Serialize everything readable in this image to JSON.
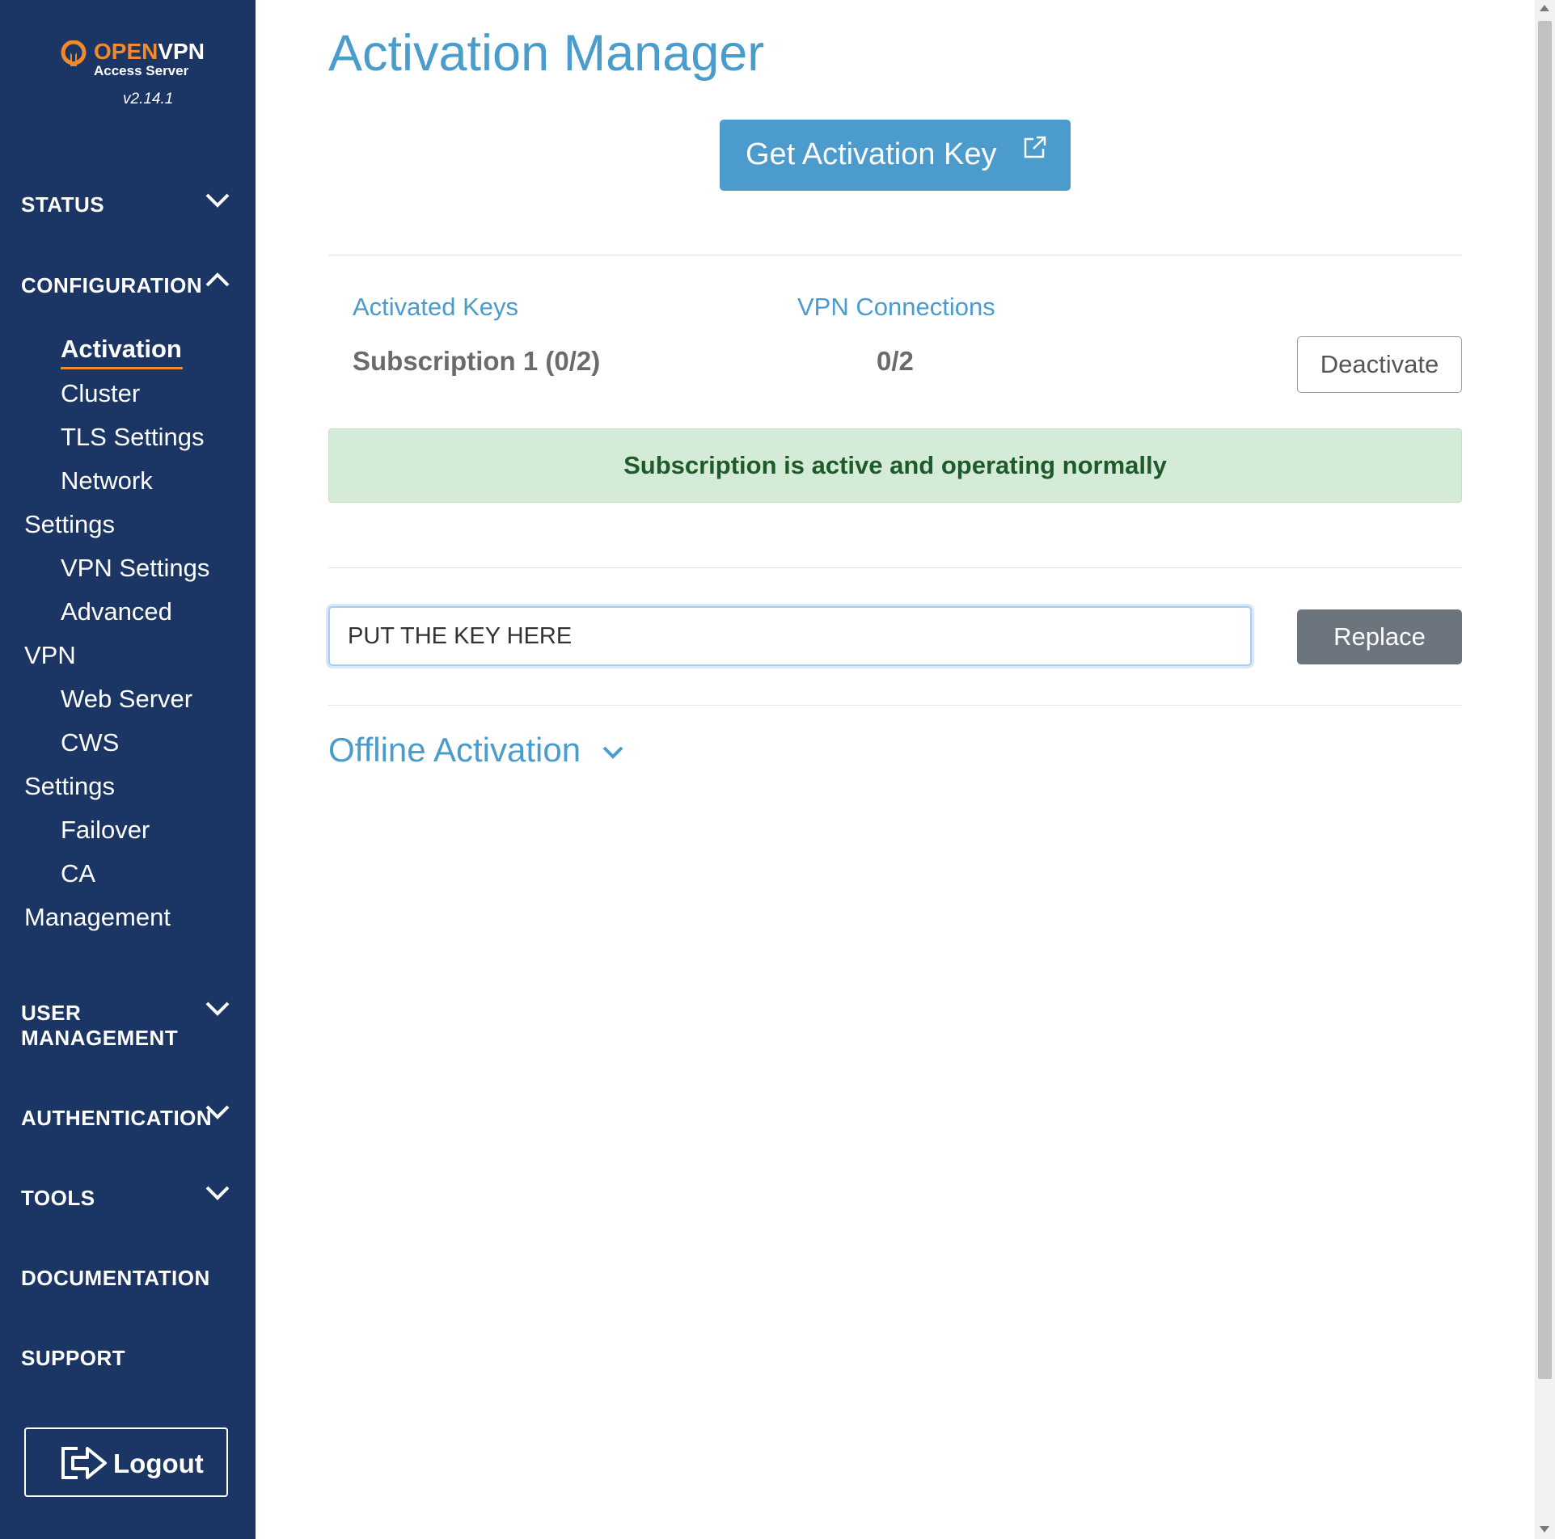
{
  "brand": {
    "logo_open": "OPEN",
    "logo_vpn": "VPN",
    "logo_sub": "Access Server",
    "version": "v2.14.1",
    "accent_color": "#f18a2c",
    "sidebar_color": "#1b3665"
  },
  "sidebar": {
    "status": "STATUS",
    "configuration": "CONFIGURATION",
    "config_items": {
      "activation": "Activation",
      "cluster": "Cluster",
      "tls_settings": "TLS Settings",
      "network": "Network",
      "network_settings": "Settings",
      "vpn_settings": "VPN Settings",
      "advanced": "Advanced",
      "advanced_vpn": "VPN",
      "web_server": "Web Server",
      "cws": "CWS",
      "cws_settings": "Settings",
      "failover": "Failover",
      "ca": "CA",
      "ca_management": "Management"
    },
    "user_management_line1": "USER",
    "user_management_line2": "MANAGEMENT",
    "authentication": "AUTHENTICATION",
    "tools": "TOOLS",
    "documentation": "DOCUMENTATION",
    "support": "SUPPORT",
    "logout": "Logout"
  },
  "main": {
    "title": "Activation Manager",
    "get_key_button": "Get Activation Key",
    "activated_keys_label": "Activated Keys",
    "vpn_connections_label": "VPN Connections",
    "subscription_name": "Subscription 1 (0/2)",
    "vpn_connections_value": "0/2",
    "deactivate_button": "Deactivate",
    "status_message": "Subscription is active and operating normally",
    "key_input_value": "PUT THE KEY HERE",
    "replace_button": "Replace",
    "offline_activation": "Offline Activation"
  }
}
